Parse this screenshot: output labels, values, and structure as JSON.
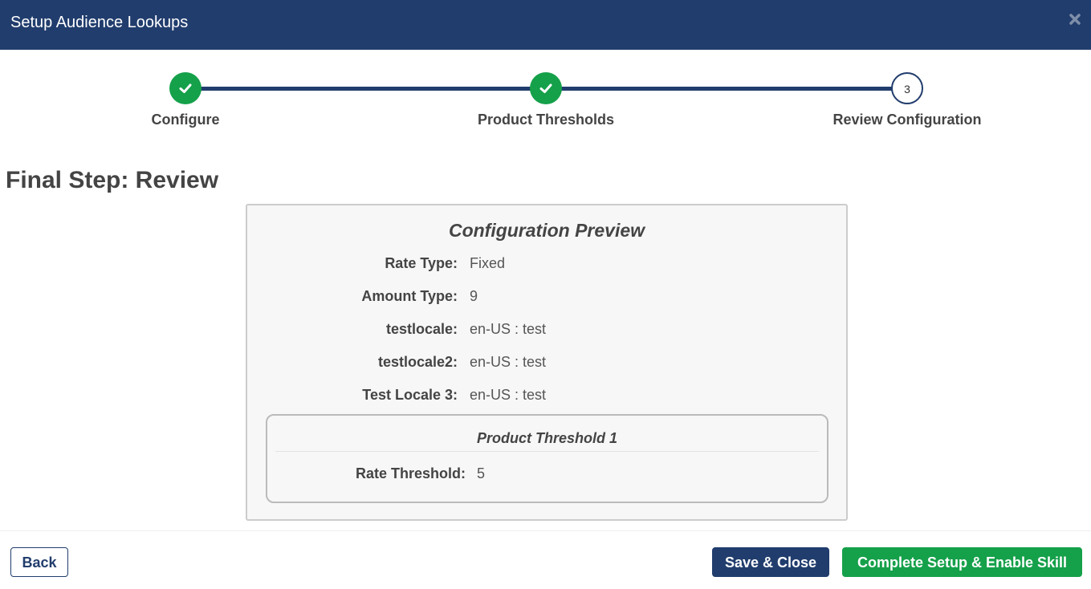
{
  "header": {
    "title": "Setup Audience Lookups",
    "close_icon": "close-icon"
  },
  "stepper": {
    "steps": [
      {
        "label": "Configure",
        "status": "complete",
        "icon": "check-icon"
      },
      {
        "label": "Product Thresholds",
        "status": "complete",
        "icon": "check-icon"
      },
      {
        "label": "Review Configuration",
        "status": "current",
        "number": "3"
      }
    ]
  },
  "page": {
    "title": "Final Step: Review"
  },
  "preview": {
    "title": "Configuration Preview",
    "rows": [
      {
        "label": "Rate Type:",
        "value": "Fixed"
      },
      {
        "label": "Amount Type:",
        "value": "9"
      },
      {
        "label": "testlocale:",
        "value": "en-US : test"
      },
      {
        "label": "testlocale2:",
        "value": "en-US : test"
      },
      {
        "label": "Test Locale 3:",
        "value": "en-US : test"
      }
    ],
    "threshold": {
      "title": "Product Threshold 1",
      "label": "Rate Threshold:",
      "value": "5"
    }
  },
  "footer": {
    "back_label": "Back",
    "save_label": "Save & Close",
    "complete_label": "Complete Setup & Enable Skill"
  },
  "colors": {
    "header_bg": "#213d6d",
    "success": "#15a04a",
    "primary": "#213d6d"
  }
}
